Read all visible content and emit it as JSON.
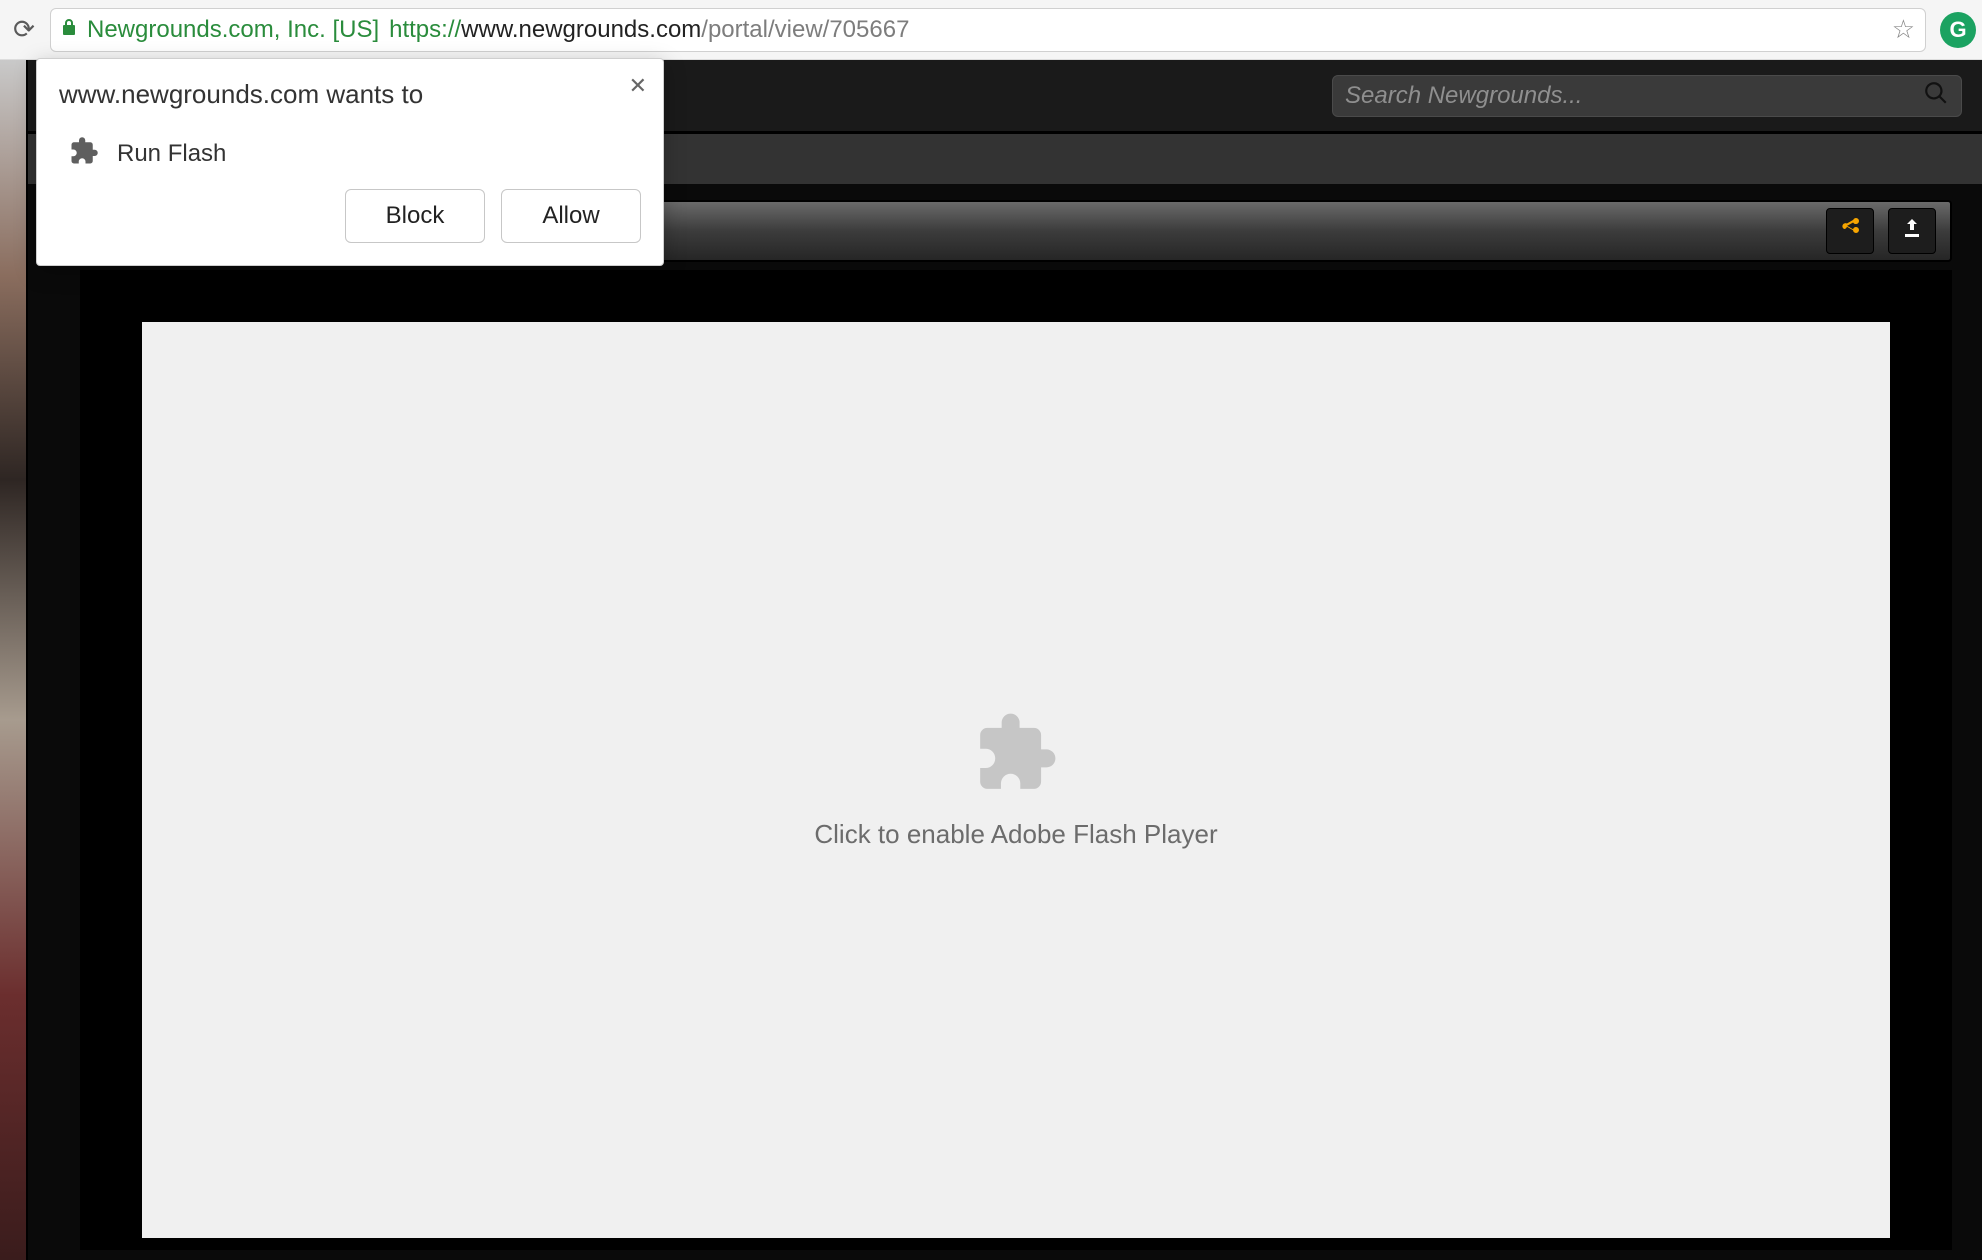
{
  "browser": {
    "ev_label": "Newgrounds.com, Inc. [US]",
    "url_scheme": "https://",
    "url_host": "www.newgrounds.com",
    "url_path": "/portal/view/705667"
  },
  "site": {
    "search_placeholder": "Search Newgrounds..."
  },
  "flash": {
    "enable_text": "Click to enable Adobe Flash Player"
  },
  "permission": {
    "title": "www.newgrounds.com wants to",
    "item": "Run Flash",
    "block": "Block",
    "allow": "Allow"
  }
}
